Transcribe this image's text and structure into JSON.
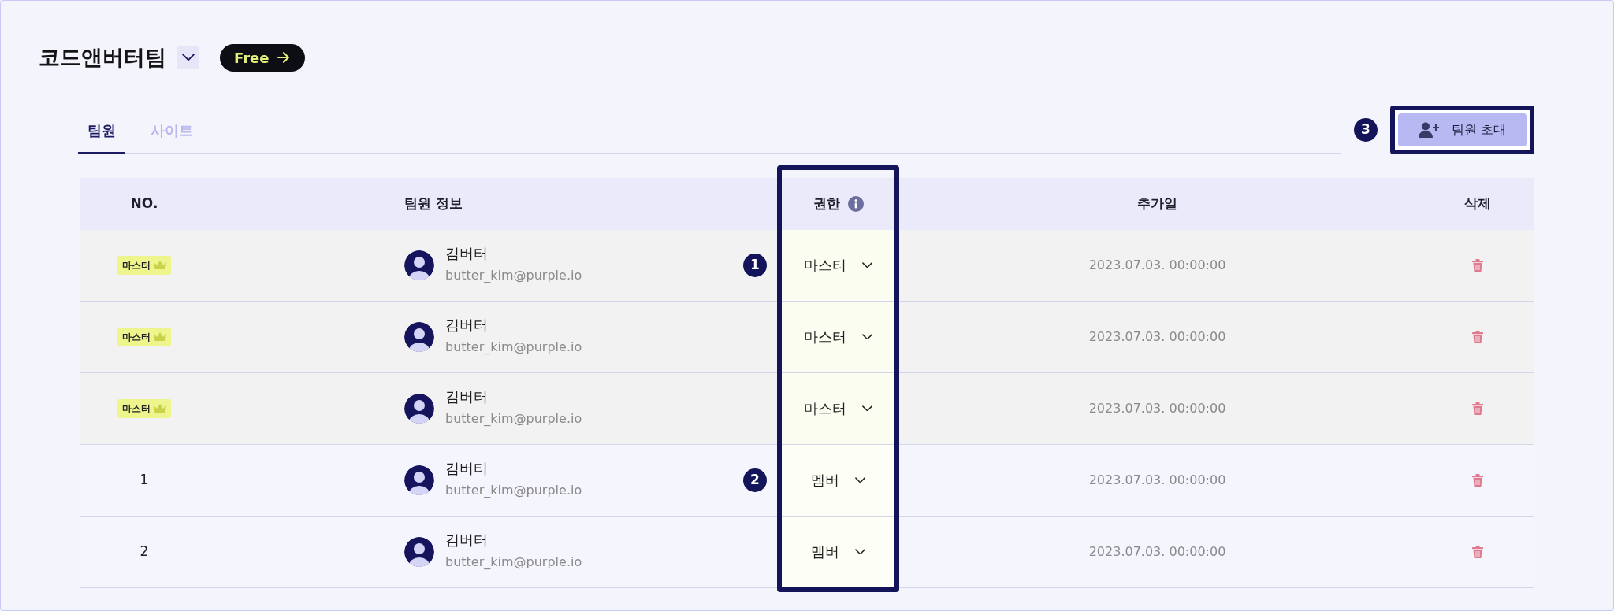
{
  "team": {
    "name": "코드앤버터팀",
    "plan": "Free"
  },
  "tabs": [
    {
      "label": "팀원",
      "selected": true
    },
    {
      "label": "사이트",
      "selected": false
    }
  ],
  "invite": {
    "label": "팀원 초대",
    "marker": "3",
    "highlighted": true
  },
  "table": {
    "columns": [
      "NO.",
      "팀원 정보",
      "권한",
      "추가일",
      "삭제"
    ],
    "role_column_highlighted": true,
    "rows": [
      {
        "kind": "master",
        "badge": "마스터",
        "name": "김버터",
        "email": "butter_kim@purple.io",
        "role": "마스터",
        "added": "2023.07.03. 00:00:00",
        "marker": "1"
      },
      {
        "kind": "master",
        "badge": "마스터",
        "name": "김버터",
        "email": "butter_kim@purple.io",
        "role": "마스터",
        "added": "2023.07.03. 00:00:00"
      },
      {
        "kind": "master",
        "badge": "마스터",
        "name": "김버터",
        "email": "butter_kim@purple.io",
        "role": "마스터",
        "added": "2023.07.03. 00:00:00"
      },
      {
        "kind": "member",
        "no": "1",
        "name": "김버터",
        "email": "butter_kim@purple.io",
        "role": "멤버",
        "added": "2023.07.03. 00:00:00",
        "marker": "2"
      },
      {
        "kind": "member",
        "no": "2",
        "name": "김버터",
        "email": "butter_kim@purple.io",
        "role": "멤버",
        "added": "2023.07.03. 00:00:00"
      }
    ]
  }
}
